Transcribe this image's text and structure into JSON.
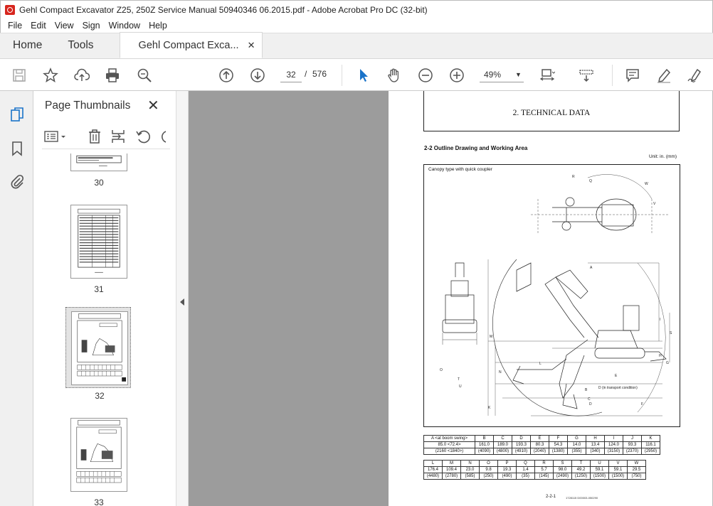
{
  "window": {
    "title": "Gehl Compact Excavator Z25, 250Z Service Manual 50940346 06.2015.pdf - Adobe Acrobat Pro DC (32-bit)"
  },
  "menu": [
    "File",
    "Edit",
    "View",
    "Sign",
    "Window",
    "Help"
  ],
  "tabs": {
    "home": "Home",
    "tools": "Tools",
    "document": "Gehl Compact Exca...",
    "close_glyph": "✕"
  },
  "toolbar": {
    "current_page": "32",
    "page_separator": "/",
    "total_pages": "576",
    "zoom": "49%",
    "zoom_arrow": "▼"
  },
  "panel": {
    "title": "Page Thumbnails",
    "close_glyph": "✕",
    "thumbnails": [
      {
        "label": "30"
      },
      {
        "label": "31"
      },
      {
        "label": "32",
        "selected": true
      },
      {
        "label": "33"
      }
    ]
  },
  "document_page": {
    "header": "2. TECHNICAL DATA",
    "section": "2-2  Outline Drawing and Working Area",
    "unit": "Unit: in. (mm)",
    "drawing_label": "Canopy type with quick coupler",
    "table1": {
      "headers": [
        "A <at boom swing>",
        "B",
        "C",
        "D",
        "E",
        "F",
        "G",
        "H",
        "I",
        "J",
        "K"
      ],
      "values_in": [
        "85.0 <72.4>",
        "161.0",
        "189.0",
        "193.3",
        "80.3",
        "54.3",
        "14.0",
        "13.4",
        "124.0",
        "93.3",
        "116.1"
      ],
      "values_mm": [
        "(2160 <1840>)",
        "(4090)",
        "(4800)",
        "(4910)",
        "(2040)",
        "(1380)",
        "(355)",
        "(340)",
        "(3150)",
        "(2370)",
        "(2950)"
      ]
    },
    "table2": {
      "headers": [
        "L",
        "M",
        "N",
        "O",
        "P",
        "Q",
        "R",
        "S",
        "T",
        "U",
        "V",
        "W"
      ],
      "values_in": [
        "176.4",
        "109.4",
        "23.0",
        "9.8",
        "19.3",
        "1.4",
        "5.7",
        "98.0",
        "49.2",
        "59.1",
        "59.1",
        "29.5"
      ],
      "values_mm": [
        "(4480)",
        "(2780)",
        "(585)",
        "(250)",
        "(490)",
        "(35)",
        "(145)",
        "(2490)",
        "(1250)",
        "(1500)",
        "(1500)",
        "(750)"
      ]
    },
    "footer": "2-2-1",
    "footer_code": "1728115   D00003-050290"
  },
  "colors": {
    "accent_blue": "#1a73c9",
    "acrobat_red": "#d7261e",
    "gray_bg": "#9c9c9c"
  }
}
